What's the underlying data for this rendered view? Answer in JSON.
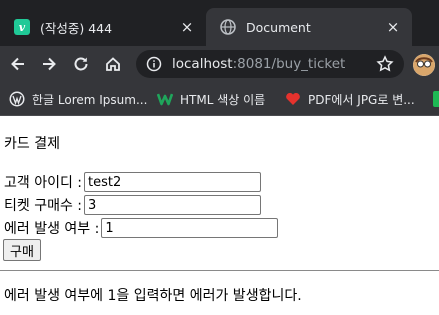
{
  "browser": {
    "tabs": [
      {
        "title": "(작성중) 444",
        "close": "×"
      },
      {
        "title": "Document",
        "close": "×"
      }
    ],
    "url": {
      "host": "localhost",
      "rest": ":8081/buy_ticket"
    },
    "bookmarks": [
      {
        "label": "한글 Lorem Ipsum...",
        "icon": "wordpress-icon"
      },
      {
        "label": "HTML 색상 이름",
        "icon": "w-logo-icon"
      },
      {
        "label": "PDF에서 JPG로 변...",
        "icon": "heart-icon"
      }
    ]
  },
  "page": {
    "title": "카드 결제",
    "fields": [
      {
        "label": "고객 아이디 :",
        "value": "test2"
      },
      {
        "label": "티켓 구매수 :",
        "value": "3"
      },
      {
        "label": "에러 발생 여부 :",
        "value": "1"
      }
    ],
    "submit_label": "구매",
    "note": "에러 발생 여부에 1을 입력하면 에러가 발생합니다."
  }
}
